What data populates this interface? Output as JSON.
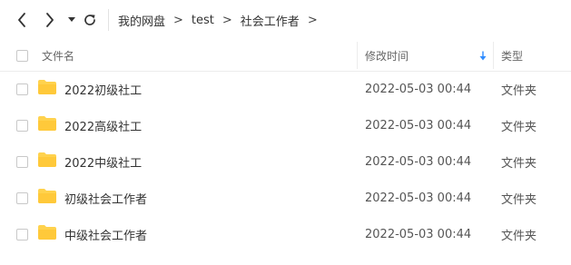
{
  "breadcrumb": [
    "我的网盘",
    "test",
    "社会工作者"
  ],
  "breadcrumb_separator": ">",
  "columns": {
    "name": "文件名",
    "modified": "修改时间",
    "type": "类型"
  },
  "files": [
    {
      "name": "2022初级社工",
      "modified": "2022-05-03 00:44",
      "type": "文件夹"
    },
    {
      "name": "2022高级社工",
      "modified": "2022-05-03 00:44",
      "type": "文件夹"
    },
    {
      "name": "2022中级社工",
      "modified": "2022-05-03 00:44",
      "type": "文件夹"
    },
    {
      "name": "初级社会工作者",
      "modified": "2022-05-03 00:44",
      "type": "文件夹"
    },
    {
      "name": "中级社会工作者",
      "modified": "2022-05-03 00:44",
      "type": "文件夹"
    }
  ],
  "colors": {
    "folder": "#ffd24d",
    "sort_arrow": "#2f8cff"
  },
  "icons": {
    "back": "chevron-left-icon",
    "forward": "chevron-right-icon",
    "dropdown": "caret-down-icon",
    "refresh": "refresh-icon",
    "sort": "sort-down-arrow-icon",
    "folder": "folder-icon"
  }
}
